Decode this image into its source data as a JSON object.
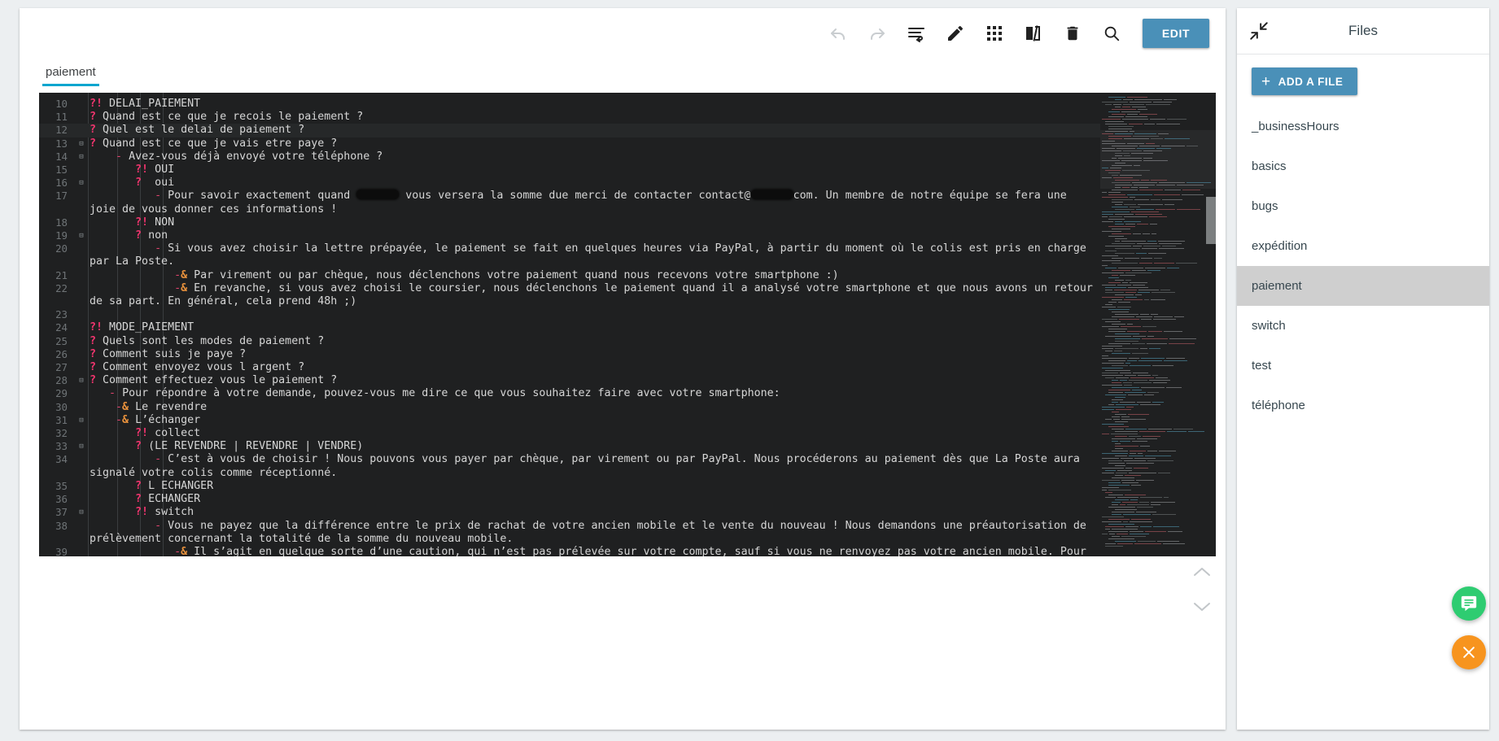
{
  "toolbar": {
    "icons": [
      {
        "name": "undo-icon",
        "title": "Undo",
        "disabled": true
      },
      {
        "name": "redo-icon",
        "title": "Redo",
        "disabled": true
      },
      {
        "name": "format-icon",
        "title": "Format",
        "disabled": false
      },
      {
        "name": "pencil-icon",
        "title": "Edit",
        "disabled": false
      },
      {
        "name": "grid-icon",
        "title": "Grid view",
        "disabled": false
      },
      {
        "name": "split-view-icon",
        "title": "Split view",
        "disabled": false
      },
      {
        "name": "trash-icon",
        "title": "Delete",
        "disabled": false
      },
      {
        "name": "search-icon",
        "title": "Search",
        "disabled": false
      }
    ],
    "edit_label": "EDIT"
  },
  "tabs": [
    {
      "label": "paiement",
      "active": true
    }
  ],
  "files": {
    "panel_title": "Files",
    "collapse_label": "Collapse",
    "add_file_label": "ADD A FILE",
    "plus_glyph": "+",
    "items": [
      {
        "label": "_businessHours",
        "active": false
      },
      {
        "label": "basics",
        "active": false
      },
      {
        "label": "bugs",
        "active": false
      },
      {
        "label": "expédition",
        "active": false
      },
      {
        "label": "paiement",
        "active": true
      },
      {
        "label": "switch",
        "active": false
      },
      {
        "label": "test",
        "active": false
      },
      {
        "label": "téléphone",
        "active": false
      }
    ]
  },
  "floating": [
    {
      "name": "chat-bubble-fab",
      "glyph": "chat",
      "color": "#2ecc71"
    },
    {
      "name": "close-fab",
      "glyph": "close",
      "color": "#f7941e"
    }
  ],
  "scroller": {
    "up_label": "Scroll up",
    "down_label": "Scroll down"
  },
  "colors": {
    "accent": "#4a90b8",
    "tab_underline": "#00a5cf",
    "editor_bg": "#1f2021",
    "keyword": "#f0356e",
    "amp": "#e8913c",
    "file_active": "#cfcfcf",
    "chat_green": "#2ecc71",
    "close_orange": "#f7941e"
  },
  "editor": {
    "first_line": 10,
    "highlighted_line": 12,
    "lines": [
      {
        "n": 10,
        "fold": false,
        "indent": 0,
        "tokens": [
          {
            "t": "kw-intent",
            "v": "?!"
          },
          {
            "t": "sp",
            "v": " "
          },
          {
            "t": "txt",
            "v": "DELAI_PAIEMENT"
          }
        ]
      },
      {
        "n": 11,
        "fold": false,
        "indent": 0,
        "tokens": [
          {
            "t": "kw-q",
            "v": "?"
          },
          {
            "t": "sp",
            "v": " "
          },
          {
            "t": "txt",
            "v": "Quand est ce que je recois le paiement ?"
          }
        ]
      },
      {
        "n": 12,
        "fold": false,
        "indent": 0,
        "hl": true,
        "tokens": [
          {
            "t": "kw-q",
            "v": "?"
          },
          {
            "t": "sp",
            "v": " "
          },
          {
            "t": "txt",
            "v": "Quel est le delai de paiement ?"
          }
        ]
      },
      {
        "n": 13,
        "fold": true,
        "indent": 0,
        "tokens": [
          {
            "t": "kw-q",
            "v": "?"
          },
          {
            "t": "sp",
            "v": " "
          },
          {
            "t": "txt",
            "v": "Quand est ce que je vais etre paye ?"
          }
        ]
      },
      {
        "n": 14,
        "fold": true,
        "indent": 1,
        "tokens": [
          {
            "t": "sp",
            "v": "    "
          },
          {
            "t": "kw-dash",
            "v": "-"
          },
          {
            "t": "sp",
            "v": " "
          },
          {
            "t": "txt",
            "v": "Avez-vous déjà envoyé votre téléphone ?"
          }
        ]
      },
      {
        "n": 15,
        "fold": false,
        "indent": 2,
        "tokens": [
          {
            "t": "sp",
            "v": "       "
          },
          {
            "t": "kw-intent",
            "v": "?!"
          },
          {
            "t": "sp",
            "v": " "
          },
          {
            "t": "txt",
            "v": "OUI"
          }
        ]
      },
      {
        "n": 16,
        "fold": true,
        "indent": 2,
        "tokens": [
          {
            "t": "sp",
            "v": "       "
          },
          {
            "t": "kw-q",
            "v": "?"
          },
          {
            "t": "sp",
            "v": "  "
          },
          {
            "t": "txt",
            "v": "oui"
          }
        ]
      },
      {
        "n": 17,
        "fold": false,
        "indent": 3,
        "tokens": [
          {
            "t": "sp",
            "v": "          "
          },
          {
            "t": "kw-dash",
            "v": "-"
          },
          {
            "t": "sp",
            "v": " "
          },
          {
            "t": "txt",
            "v": "Pour savoir exactement quand "
          },
          {
            "t": "redact",
            "v": "",
            "w": 52
          },
          {
            "t": "txt",
            "v": " vous versera la somme due merci de contacter contact@"
          },
          {
            "t": "redact",
            "v": "",
            "w": 52
          },
          {
            "t": "txt",
            "v": "com. Un membre de notre équipe se fera une joie de vous donner ces informations !"
          }
        ]
      },
      {
        "n": 18,
        "fold": false,
        "indent": 2,
        "tokens": [
          {
            "t": "sp",
            "v": "       "
          },
          {
            "t": "kw-intent",
            "v": "?!"
          },
          {
            "t": "sp",
            "v": " "
          },
          {
            "t": "txt",
            "v": "NON"
          }
        ]
      },
      {
        "n": 19,
        "fold": true,
        "indent": 2,
        "tokens": [
          {
            "t": "sp",
            "v": "       "
          },
          {
            "t": "kw-q",
            "v": "?"
          },
          {
            "t": "sp",
            "v": " "
          },
          {
            "t": "txt",
            "v": "non"
          }
        ]
      },
      {
        "n": 20,
        "fold": false,
        "indent": 3,
        "tokens": [
          {
            "t": "sp",
            "v": "          "
          },
          {
            "t": "kw-dash",
            "v": "-"
          },
          {
            "t": "sp",
            "v": " "
          },
          {
            "t": "txt",
            "v": "Si vous avez choisir la lettre prépayée, le paiement se fait en quelques heures via PayPal, à partir du moment où le colis est pris en charge par La Poste."
          }
        ]
      },
      {
        "n": 21,
        "fold": false,
        "indent": 4,
        "tokens": [
          {
            "t": "sp",
            "v": "             "
          },
          {
            "t": "kw-dash",
            "v": "-"
          },
          {
            "t": "kw-amp",
            "v": "&"
          },
          {
            "t": "sp",
            "v": " "
          },
          {
            "t": "txt",
            "v": "Par virement ou par chèque, nous déclenchons votre paiement quand nous recevons votre smartphone :)"
          }
        ]
      },
      {
        "n": 22,
        "fold": false,
        "indent": 4,
        "tokens": [
          {
            "t": "sp",
            "v": "             "
          },
          {
            "t": "kw-dash",
            "v": "-"
          },
          {
            "t": "kw-amp",
            "v": "&"
          },
          {
            "t": "sp",
            "v": " "
          },
          {
            "t": "txt",
            "v": "En revanche, si vous avez choisi le coursier, nous déclenchons le paiement quand il a analysé votre smartphone et que nous avons un retour de sa part. En général, cela prend 48h ;)"
          }
        ]
      },
      {
        "n": 23,
        "fold": false,
        "indent": 0,
        "tokens": []
      },
      {
        "n": 24,
        "fold": false,
        "indent": 0,
        "tokens": [
          {
            "t": "kw-intent",
            "v": "?!"
          },
          {
            "t": "sp",
            "v": " "
          },
          {
            "t": "txt",
            "v": "MODE_PAIEMENT"
          }
        ]
      },
      {
        "n": 25,
        "fold": false,
        "indent": 0,
        "tokens": [
          {
            "t": "kw-q",
            "v": "?"
          },
          {
            "t": "sp",
            "v": " "
          },
          {
            "t": "txt",
            "v": "Quels sont les modes de paiement ?"
          }
        ]
      },
      {
        "n": 26,
        "fold": false,
        "indent": 0,
        "tokens": [
          {
            "t": "kw-q",
            "v": "?"
          },
          {
            "t": "sp",
            "v": " "
          },
          {
            "t": "txt",
            "v": "Comment suis je paye ?"
          }
        ]
      },
      {
        "n": 27,
        "fold": false,
        "indent": 0,
        "tokens": [
          {
            "t": "kw-q",
            "v": "?"
          },
          {
            "t": "sp",
            "v": " "
          },
          {
            "t": "txt",
            "v": "Comment envoyez vous l argent ?"
          }
        ]
      },
      {
        "n": 28,
        "fold": true,
        "indent": 0,
        "tokens": [
          {
            "t": "kw-q",
            "v": "?"
          },
          {
            "t": "sp",
            "v": " "
          },
          {
            "t": "txt",
            "v": "Comment effectuez vous le paiement ?"
          }
        ]
      },
      {
        "n": 29,
        "fold": false,
        "indent": 1,
        "tokens": [
          {
            "t": "sp",
            "v": "   "
          },
          {
            "t": "kw-dash",
            "v": "-"
          },
          {
            "t": "sp",
            "v": " "
          },
          {
            "t": "txt",
            "v": "Pour répondre à votre demande, pouvez-vous me dire ce que vous souhaitez faire avec votre smartphone:"
          }
        ]
      },
      {
        "n": 30,
        "fold": false,
        "indent": 1,
        "tokens": [
          {
            "t": "sp",
            "v": "    "
          },
          {
            "t": "kw-dash",
            "v": "-"
          },
          {
            "t": "kw-amp",
            "v": "&"
          },
          {
            "t": "sp",
            "v": " "
          },
          {
            "t": "txt",
            "v": "Le revendre"
          }
        ]
      },
      {
        "n": 31,
        "fold": true,
        "indent": 1,
        "tokens": [
          {
            "t": "sp",
            "v": "    "
          },
          {
            "t": "kw-dash",
            "v": "-"
          },
          {
            "t": "kw-amp",
            "v": "&"
          },
          {
            "t": "sp",
            "v": " "
          },
          {
            "t": "txt",
            "v": "L’échanger"
          }
        ]
      },
      {
        "n": 32,
        "fold": false,
        "indent": 2,
        "tokens": [
          {
            "t": "sp",
            "v": "       "
          },
          {
            "t": "kw-intent",
            "v": "?!"
          },
          {
            "t": "sp",
            "v": " "
          },
          {
            "t": "txt",
            "v": "collect"
          }
        ]
      },
      {
        "n": 33,
        "fold": true,
        "indent": 2,
        "tokens": [
          {
            "t": "sp",
            "v": "       "
          },
          {
            "t": "kw-q",
            "v": "?"
          },
          {
            "t": "sp",
            "v": " "
          },
          {
            "t": "txt",
            "v": "(LE REVENDRE | REVENDRE | VENDRE)"
          }
        ]
      },
      {
        "n": 34,
        "fold": false,
        "indent": 3,
        "tokens": [
          {
            "t": "sp",
            "v": "          "
          },
          {
            "t": "kw-dash",
            "v": "-"
          },
          {
            "t": "sp",
            "v": " "
          },
          {
            "t": "txt",
            "v": "C’est à vous de choisir ! Nous pouvons vous payer par chèque, par virement ou par PayPal. Nous procéderons au paiement dès que La Poste aura signalé votre colis comme réceptionné."
          }
        ]
      },
      {
        "n": 35,
        "fold": false,
        "indent": 2,
        "tokens": [
          {
            "t": "sp",
            "v": "       "
          },
          {
            "t": "kw-q",
            "v": "?"
          },
          {
            "t": "sp",
            "v": " "
          },
          {
            "t": "txt",
            "v": "L ECHANGER"
          }
        ]
      },
      {
        "n": 36,
        "fold": false,
        "indent": 2,
        "tokens": [
          {
            "t": "sp",
            "v": "       "
          },
          {
            "t": "kw-q",
            "v": "?"
          },
          {
            "t": "sp",
            "v": " "
          },
          {
            "t": "txt",
            "v": "ECHANGER"
          }
        ]
      },
      {
        "n": 37,
        "fold": true,
        "indent": 2,
        "tokens": [
          {
            "t": "sp",
            "v": "       "
          },
          {
            "t": "kw-intent",
            "v": "?!"
          },
          {
            "t": "sp",
            "v": " "
          },
          {
            "t": "txt",
            "v": "switch"
          }
        ]
      },
      {
        "n": 38,
        "fold": false,
        "indent": 3,
        "tokens": [
          {
            "t": "sp",
            "v": "          "
          },
          {
            "t": "kw-dash",
            "v": "-"
          },
          {
            "t": "sp",
            "v": " "
          },
          {
            "t": "txt",
            "v": "Vous ne payez que la différence entre le prix de rachat de votre ancien mobile et le vente du nouveau ! Nous demandons une préautorisation de prélèvement concernant la totalité de la somme du nouveau mobile."
          }
        ]
      },
      {
        "n": 39,
        "fold": false,
        "indent": 4,
        "tokens": [
          {
            "t": "sp",
            "v": "             "
          },
          {
            "t": "kw-dash",
            "v": "-"
          },
          {
            "t": "kw-amp",
            "v": "&"
          },
          {
            "t": "sp",
            "v": " "
          },
          {
            "t": "txt",
            "v": "Il s’agit en quelque sorte d’une caution, qui n’est pas prélevée sur votre compte, sauf si vous ne renvoyez pas votre ancien mobile. Pour plus"
          }
        ]
      }
    ]
  }
}
